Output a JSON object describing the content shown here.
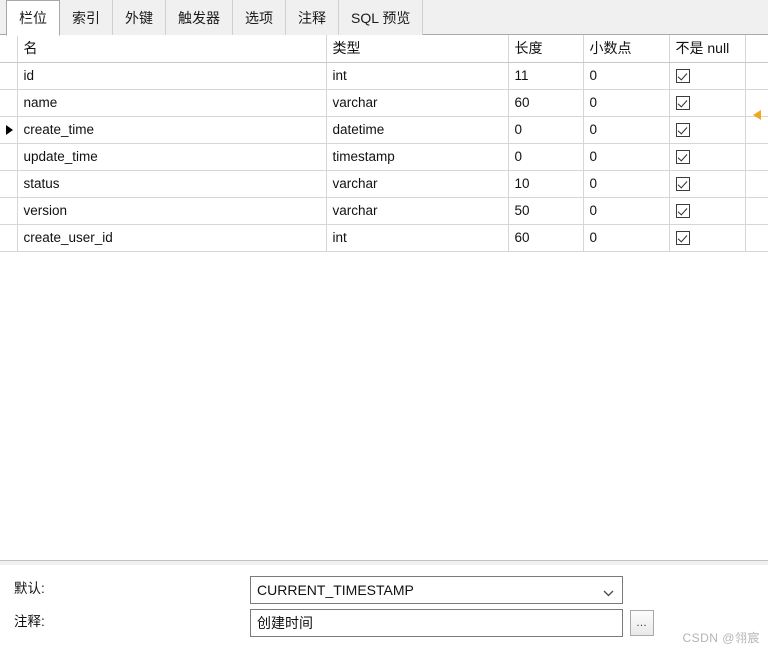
{
  "tabs": [
    {
      "label": "栏位",
      "active": true
    },
    {
      "label": "索引",
      "active": false
    },
    {
      "label": "外键",
      "active": false
    },
    {
      "label": "触发器",
      "active": false
    },
    {
      "label": "选项",
      "active": false
    },
    {
      "label": "注释",
      "active": false
    },
    {
      "label": "SQL 预览",
      "active": false
    }
  ],
  "grid": {
    "columns": [
      "名",
      "类型",
      "长度",
      "小数点",
      "不是 null"
    ],
    "rows": [
      {
        "selected": false,
        "name": "id",
        "type": "int",
        "length": "11",
        "decimals": "0",
        "not_null": true
      },
      {
        "selected": false,
        "name": "name",
        "type": "varchar",
        "length": "60",
        "decimals": "0",
        "not_null": true
      },
      {
        "selected": true,
        "name": "create_time",
        "type": "datetime",
        "length": "0",
        "decimals": "0",
        "not_null": true
      },
      {
        "selected": false,
        "name": "update_time",
        "type": "timestamp",
        "length": "0",
        "decimals": "0",
        "not_null": true
      },
      {
        "selected": false,
        "name": "status",
        "type": "varchar",
        "length": "10",
        "decimals": "0",
        "not_null": true
      },
      {
        "selected": false,
        "name": "version",
        "type": "varchar",
        "length": "50",
        "decimals": "0",
        "not_null": true
      },
      {
        "selected": false,
        "name": "create_user_id",
        "type": "int",
        "length": "60",
        "decimals": "0",
        "not_null": true
      }
    ]
  },
  "details": {
    "default_label": "默认:",
    "default_value": "CURRENT_TIMESTAMP",
    "comment_label": "注释:",
    "comment_value": "创建时间",
    "more_button_label": "…"
  },
  "watermark": "CSDN @翎宸",
  "colors": {
    "marker_orange": "#f0a81e",
    "tab_bar_bg": "#f0f0f0",
    "grid_line": "#d6d6d6"
  }
}
